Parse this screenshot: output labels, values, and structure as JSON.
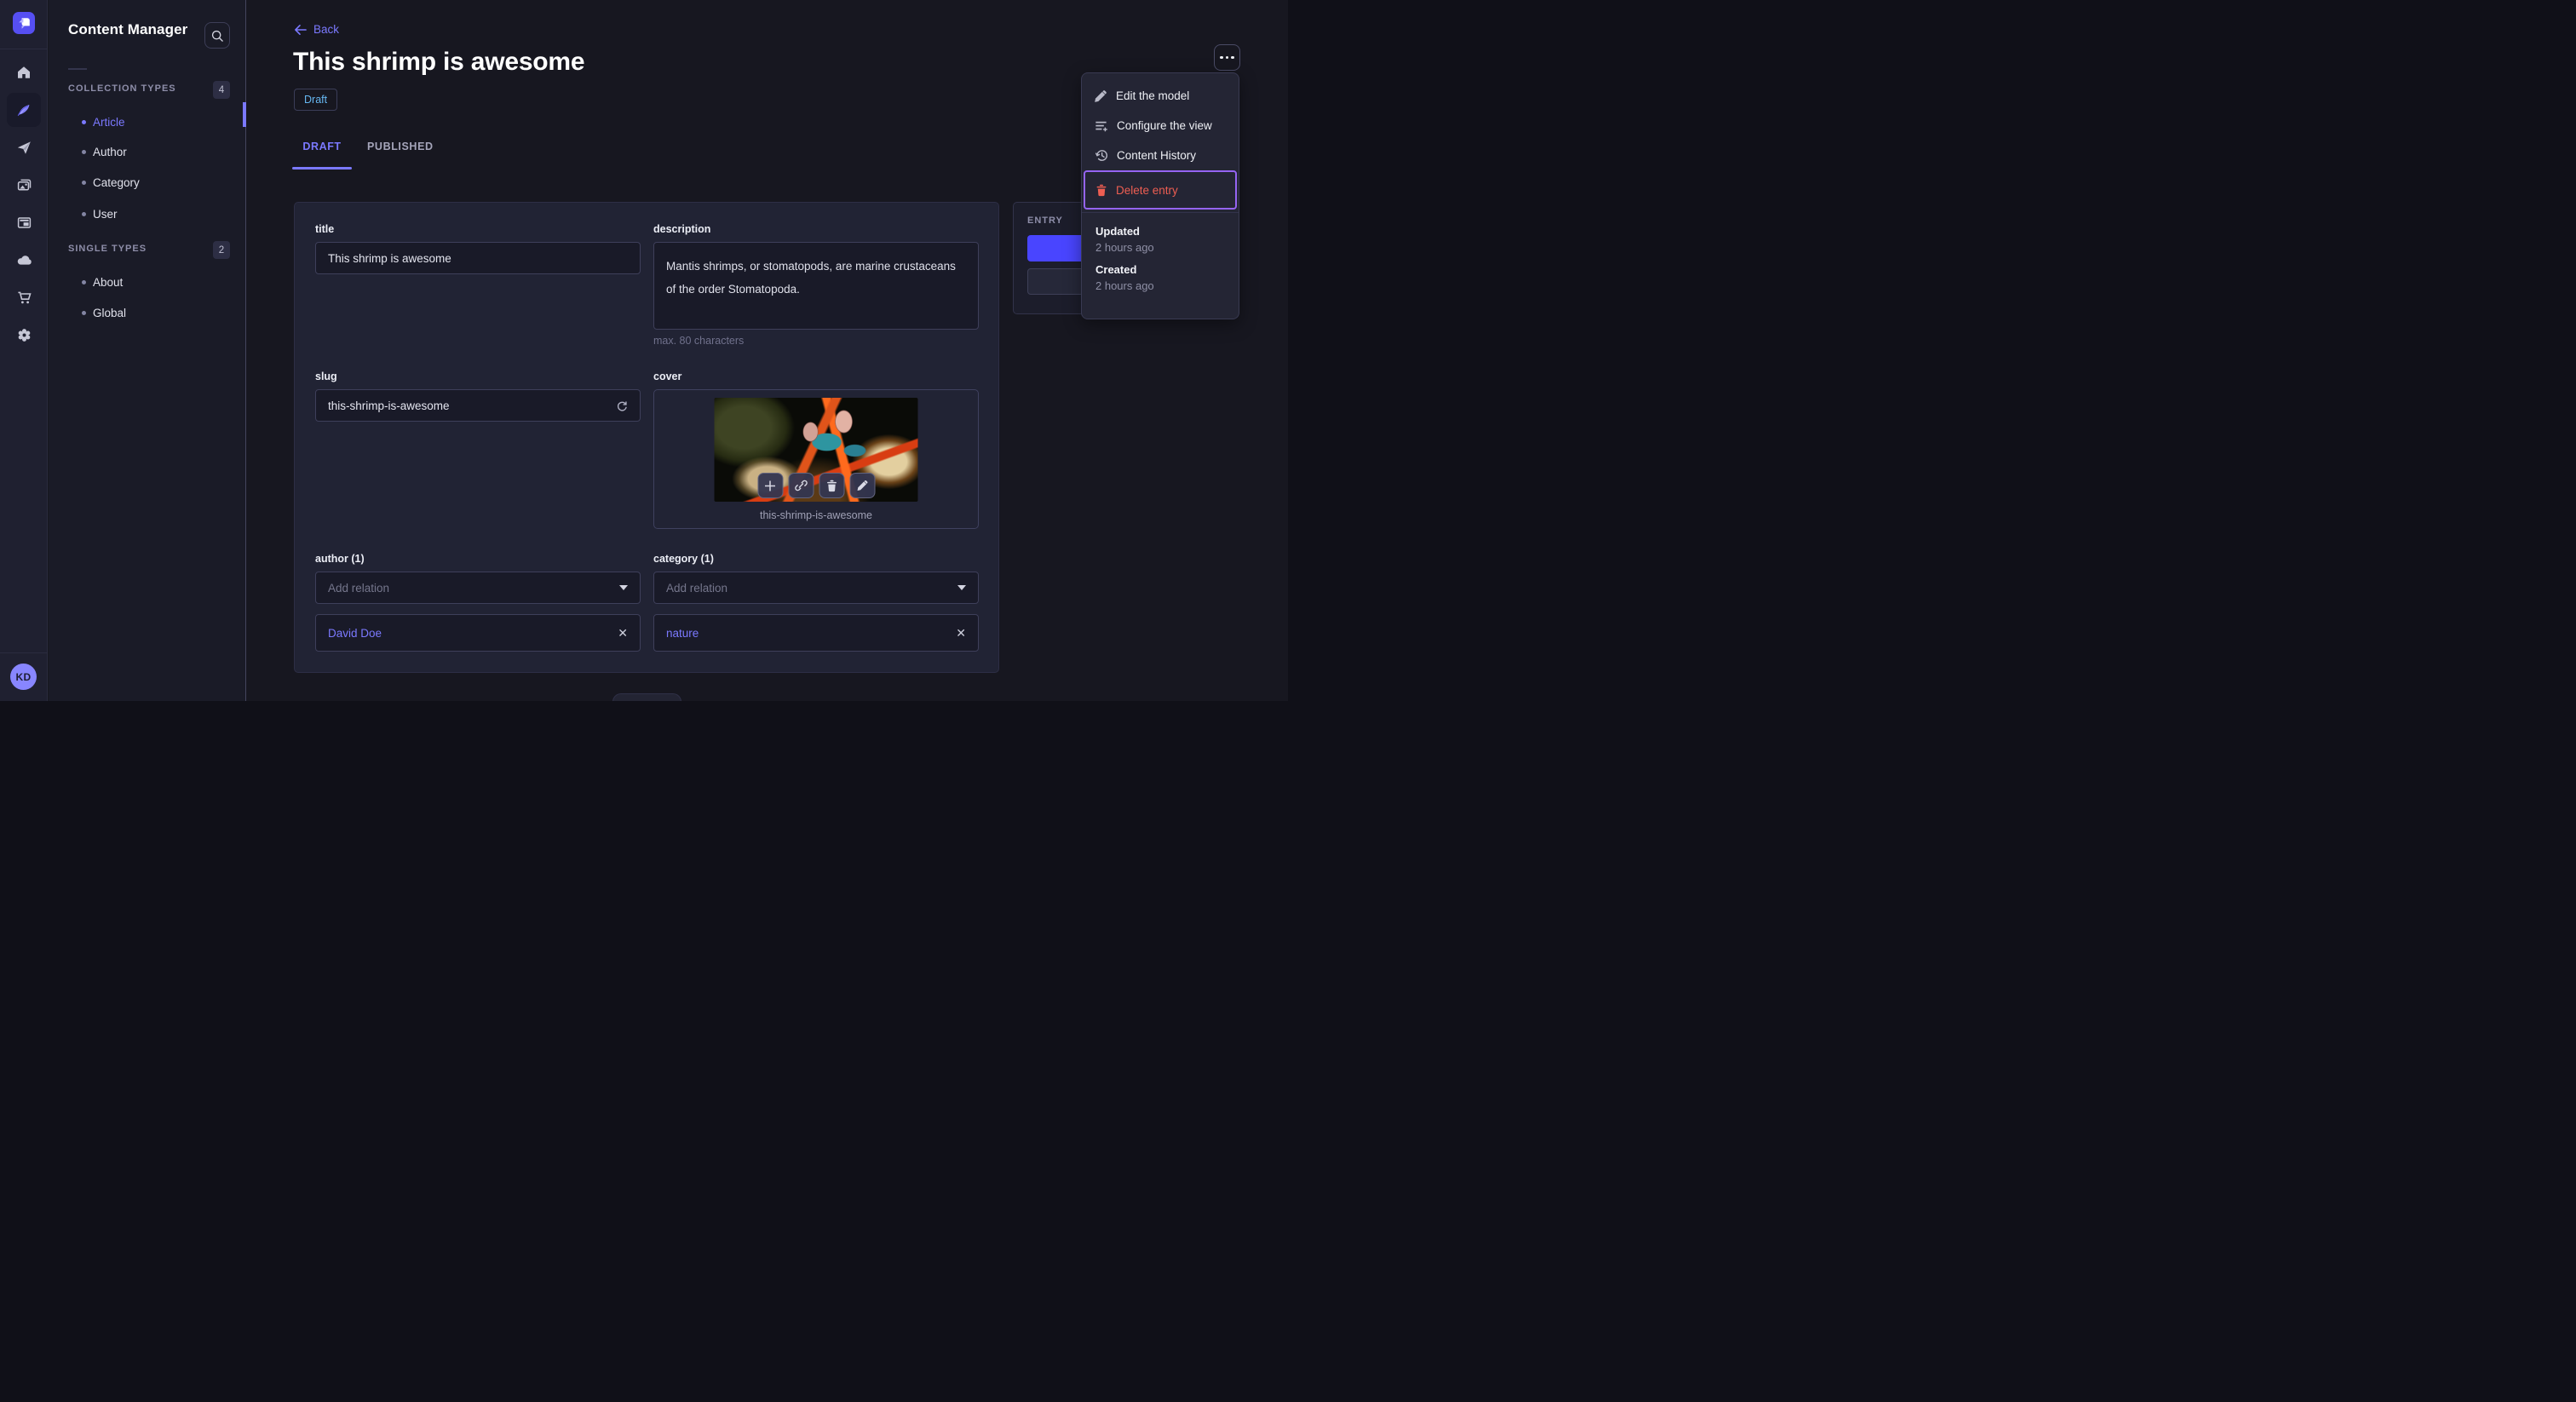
{
  "colors": {
    "accent": "#4945ff",
    "link_purple": "#7b79ff",
    "danger_red": "#ee5e52",
    "highlight_purple": "#9564f2",
    "draft_blue": "#66b7f1"
  },
  "sidebar": {
    "logo_icon": "strapi-logo",
    "avatar_initials": "KD",
    "items": [
      {
        "name": "home",
        "icon": "home-icon",
        "active": false
      },
      {
        "name": "content-manager",
        "icon": "feather-icon",
        "active": true
      },
      {
        "name": "releases",
        "icon": "paper-plane-icon",
        "active": false
      },
      {
        "name": "media-library",
        "icon": "images-icon",
        "active": false
      },
      {
        "name": "content-type-builder",
        "icon": "layout-icon",
        "active": false
      },
      {
        "name": "deploy",
        "icon": "cloud-icon",
        "active": false
      },
      {
        "name": "marketplace",
        "icon": "cart-icon",
        "active": false
      },
      {
        "name": "settings",
        "icon": "gear-icon",
        "active": false
      }
    ]
  },
  "subnav": {
    "title": "Content Manager",
    "search_icon": "search-icon",
    "sections": [
      {
        "label": "COLLECTION TYPES",
        "count": "4",
        "items": [
          {
            "label": "Article",
            "active": true
          },
          {
            "label": "Author",
            "active": false
          },
          {
            "label": "Category",
            "active": false
          },
          {
            "label": "User",
            "active": false
          }
        ]
      },
      {
        "label": "SINGLE TYPES",
        "count": "2",
        "items": [
          {
            "label": "About",
            "active": false
          },
          {
            "label": "Global",
            "active": false
          }
        ]
      }
    ]
  },
  "header": {
    "back_label": "Back",
    "title": "This shrimp is awesome",
    "status_badge": "Draft",
    "tabs": [
      {
        "label": "DRAFT",
        "active": true
      },
      {
        "label": "PUBLISHED",
        "active": false
      }
    ],
    "more_button_icon": "ellipsis-icon"
  },
  "form": {
    "title": {
      "label": "title",
      "value": "This shrimp is awesome"
    },
    "description": {
      "label": "description",
      "value": "Mantis shrimps, or stomatopods, are marine crustaceans of the order Stomatopoda.",
      "hint": "max. 80 characters"
    },
    "slug": {
      "label": "slug",
      "value": "this-shrimp-is-awesome",
      "action_icon": "refresh-icon"
    },
    "cover": {
      "label": "cover",
      "caption": "this-shrimp-is-awesome",
      "action_icons": [
        "plus-icon",
        "link-icon",
        "trash-icon",
        "pencil-icon"
      ]
    },
    "author": {
      "label": "author (1)",
      "placeholder": "Add relation",
      "relation": "David Doe"
    },
    "category": {
      "label": "category (1)",
      "placeholder": "Add relation",
      "relation": "nature"
    }
  },
  "entry_panel": {
    "label": "ENTRY"
  },
  "menu": {
    "items": [
      {
        "label": "Edit the model",
        "icon": "pencil-icon",
        "danger": false,
        "highlighted": false
      },
      {
        "label": "Configure the view",
        "icon": "list-plus-icon",
        "danger": false,
        "highlighted": false
      },
      {
        "label": "Content History",
        "icon": "history-clock-icon",
        "danger": false,
        "highlighted": false
      },
      {
        "label": "Delete entry",
        "icon": "trash-icon",
        "danger": true,
        "highlighted": true
      }
    ],
    "meta": [
      {
        "label": "Updated",
        "value": "2 hours ago"
      },
      {
        "label": "Created",
        "value": "2 hours ago"
      }
    ]
  }
}
